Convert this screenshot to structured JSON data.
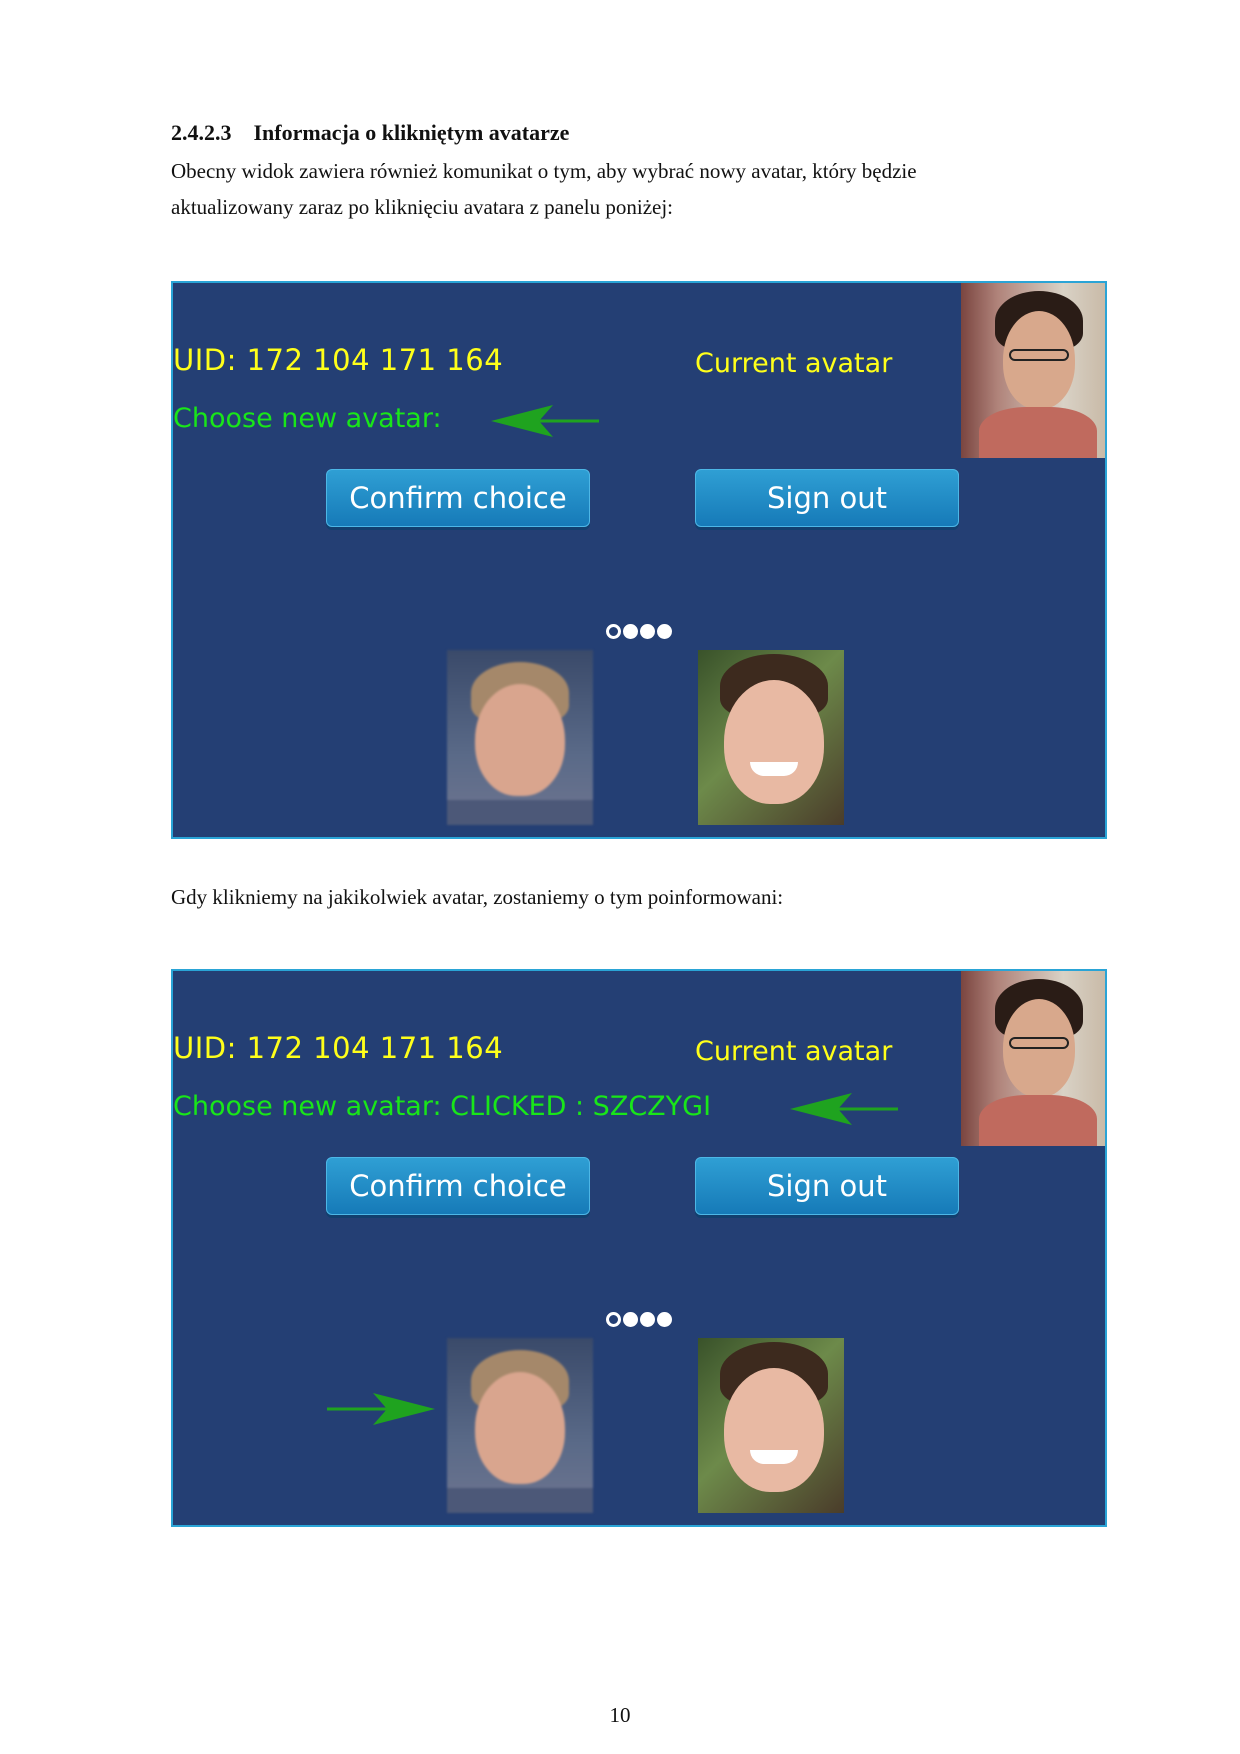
{
  "section": {
    "number": "2.4.2.3",
    "title": "Informacja o klikniętym avatarze"
  },
  "paragraph1_line1": "Obecny widok zawiera również komunikat o tym, aby wybrać nowy avatar, który będzie",
  "paragraph1_line2": "aktualizowany zaraz po kliknięciu avatara z panelu poniżej:",
  "paragraph2": "Gdy klikniemy na jakikolwiek avatar, zostaniemy o tym poinformowani:",
  "page_number": "10",
  "screenshot1": {
    "uid_label": "UID: 172 104 171 164",
    "current_avatar_label": "Current avatar",
    "choose_label": "Choose new avatar:",
    "confirm_button": "Confirm choice",
    "signout_button": "Sign out"
  },
  "screenshot2": {
    "uid_label": "UID: 172 104 171 164",
    "current_avatar_label": "Current avatar",
    "choose_label": "Choose new avatar: CLICKED : SZCZYGI",
    "confirm_button": "Confirm choice",
    "signout_button": "Sign out"
  },
  "colors": {
    "panel_bg": "#243f74",
    "panel_border": "#2aa4d6",
    "uid_text": "#ffff1a",
    "choose_text": "#19e619",
    "arrow": "#1fa31f",
    "button": "#1f8cc7"
  },
  "carousel": {
    "page_count": 4,
    "active_index": 0
  }
}
